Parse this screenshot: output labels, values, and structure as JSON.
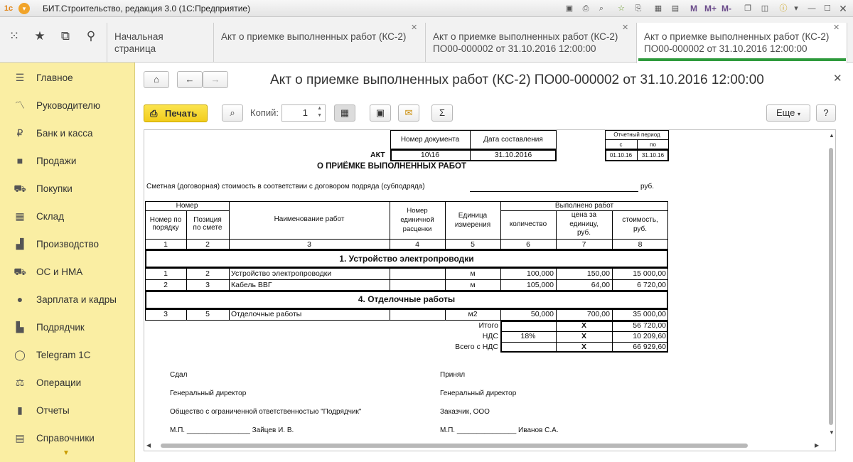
{
  "window": {
    "title": "БИТ.Строительство, редакция 3.0  (1С:Предприятие)",
    "m_buttons": [
      "M",
      "M+",
      "M-"
    ]
  },
  "tabs": [
    {
      "line1": "Начальная страница",
      "line2": ""
    },
    {
      "line1": "Акт о приемке выполненных работ (КС-2)",
      "line2": ""
    },
    {
      "line1": "Акт о приемке выполненных работ (КС-2)",
      "line2": "ПО00-000002 от 31.10.2016 12:00:00"
    },
    {
      "line1": "Акт о приемке выполненных работ (КС-2)",
      "line2": "ПО00-000002 от 31.10.2016 12:00:00"
    }
  ],
  "sidebar": {
    "items": [
      {
        "label": "Главное",
        "icon": "menu-icon"
      },
      {
        "label": "Руководителю",
        "icon": "trend-icon"
      },
      {
        "label": "Банк и касса",
        "icon": "coin-icon"
      },
      {
        "label": "Продажи",
        "icon": "bag-icon"
      },
      {
        "label": "Покупки",
        "icon": "cart-icon"
      },
      {
        "label": "Склад",
        "icon": "warehouse-icon"
      },
      {
        "label": "Производство",
        "icon": "factory-icon"
      },
      {
        "label": "ОС и НМА",
        "icon": "truck-icon"
      },
      {
        "label": "Зарплата и кадры",
        "icon": "person-icon"
      },
      {
        "label": "Подрядчик",
        "icon": "building-icon"
      },
      {
        "label": "Telegram 1C",
        "icon": "chat-icon"
      },
      {
        "label": "Операции",
        "icon": "operations-icon"
      },
      {
        "label": "Отчеты",
        "icon": "bar-chart-icon"
      },
      {
        "label": "Справочники",
        "icon": "book-icon"
      }
    ]
  },
  "document": {
    "title": "Акт о приемке выполненных работ (КС-2) ПО00-000002 от 31.10.2016 12:00:00",
    "print_label": "Печать",
    "copies_label": "Копий:",
    "copies_value": "1",
    "more_label": "Еще",
    "help_label": "?"
  },
  "form": {
    "doc_number_header": "Номер документа",
    "date_header": "Дата составления",
    "act_label": "АКТ",
    "act_number": "10\\16",
    "act_date": "31.10.2016",
    "period_header": "Отчетный период",
    "period_from_label": "с",
    "period_to_label": "по",
    "period_from": "01.10.16",
    "period_to": "31.10.16",
    "subtitle": "О ПРИЁМКЕ ВЫПОЛНЕННЫХ РАБОТ",
    "cost_line": "Сметная (договорная) стоимость в соответствии с договором подряда (субподряда)",
    "rub": "руб.",
    "headers": {
      "number": "Номер",
      "order_no_1": "Номер по",
      "order_no_2": "порядку",
      "position_1": "Позиция",
      "position_2": "по смете",
      "work_name": "Наименование работ",
      "unit_price_no_1": "Номер",
      "unit_price_no_2": "единичной",
      "unit_price_no_3": "расценки",
      "unit_1": "Единица",
      "unit_2": "измерения",
      "done": "Выполнено работ",
      "qty": "количество",
      "price_1": "цена за",
      "price_2": "единицу,",
      "price_3": "руб.",
      "cost_1": "стоимость,",
      "cost_2": "руб."
    },
    "col_numbers": [
      "1",
      "2",
      "3",
      "4",
      "5",
      "6",
      "7",
      "8"
    ],
    "section1": "1. Устройство электропроводки",
    "section2": "4. Отделочные работы",
    "rows": [
      {
        "n": "1",
        "pos": "2",
        "name": "Устройство электропроводки",
        "unit": "м",
        "qty": "100,000",
        "price": "150,00",
        "cost": "15 000,00"
      },
      {
        "n": "2",
        "pos": "3",
        "name": "Кабель ВВГ",
        "unit": "м",
        "qty": "105,000",
        "price": "64,00",
        "cost": "6 720,00"
      },
      {
        "n": "3",
        "pos": "5",
        "name": "Отделочные работы",
        "unit": "м2",
        "qty": "50,000",
        "price": "700,00",
        "cost": "35 000,00"
      }
    ],
    "totals": {
      "itogo_label": "Итого",
      "itogo_x": "X",
      "itogo": "56 720,00",
      "nds_label": "НДС",
      "nds_rate": "18%",
      "nds_x": "X",
      "nds": "10 209,60",
      "total_label": "Всего с НДС",
      "total_x": "X",
      "total": "66 929,60"
    },
    "signatures": {
      "gave": "Сдал",
      "received": "Принял",
      "gd_left": "Генеральный директор",
      "gd_right": "Генеральный директор",
      "org_left": "Общество с ограниченной ответственностью \"Подрядчик\"",
      "org_right": "Заказчик, ООО",
      "mp_left": "М.П. ________________ Зайцев И. В.",
      "mp_right": "М.П. _______________ Иванов С.А."
    }
  }
}
